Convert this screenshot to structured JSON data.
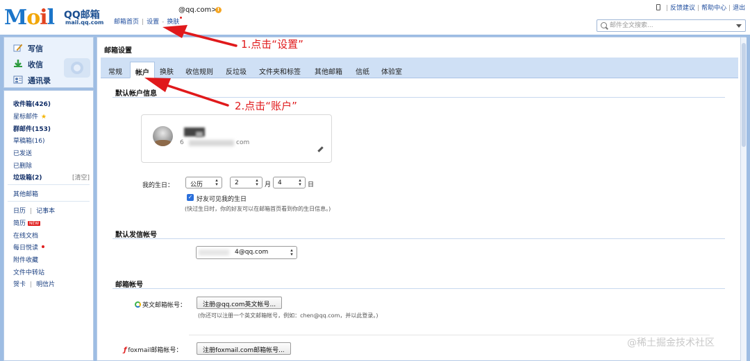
{
  "header": {
    "logo_text": "Mail",
    "logo_brand": "QQ邮箱",
    "logo_url": "mail.qq.com",
    "user_email": "@qq.com>",
    "nav": [
      "邮箱首页",
      "设置",
      "换肤"
    ],
    "top_links": [
      "反馈建议",
      "帮助中心",
      "退出"
    ],
    "search_placeholder": "邮件全文搜索..."
  },
  "sidebar": {
    "quick_actions": [
      "写信",
      "收信",
      "通讯录"
    ],
    "folders": [
      {
        "label": "收件箱(426)",
        "bold": true
      },
      {
        "label": "星标邮件",
        "bold": false
      },
      {
        "label": "群邮件(153)",
        "bold": true
      },
      {
        "label": "草稿箱(16)",
        "bold": false
      },
      {
        "label": "已发送",
        "bold": false
      },
      {
        "label": "已删除",
        "bold": false
      },
      {
        "label": "垃圾箱(2)",
        "bold": true
      }
    ],
    "clear_label": "[清空]",
    "other_mailbox": "其他邮箱",
    "calendar": "日历",
    "notes": "记事本",
    "resume": "简历",
    "new_badge": "NEW",
    "online_docs": "在线文档",
    "daily_read": "每日悦读",
    "attachments": "附件收藏",
    "file_transfer": "文件中转站",
    "greeting_card": "贺卡",
    "postcard": "明信片"
  },
  "main": {
    "title": "邮箱设置",
    "tabs": [
      "常规",
      "帐户",
      "换肤",
      "收信规则",
      "反垃圾",
      "文件夹和标签",
      "其他邮箱",
      "信纸",
      "体验室"
    ],
    "active_tab": 1,
    "section_default_account": "默认帐户信息",
    "account_email_prefix": "6",
    "account_email_suffix": "com",
    "birthday": {
      "label": "我的生日：",
      "calendar_type": "公历",
      "month": "2",
      "month_unit": "月",
      "day": "4",
      "day_unit": "日",
      "checkbox_label": "好友可见我的生日",
      "hint": "(快过生日时，你的好友可以在邮箱首页看到你的生日信息。)"
    },
    "section_default_sender": "默认发信帐号",
    "sender_value": "4@qq.com",
    "section_mail_account": "邮箱帐号",
    "english_account_label": "英文邮箱帐号：",
    "english_account_button": "注册@qq.com英文帐号...",
    "english_account_hint": "(你还可以注册一个英文邮箱帐号，例如：chen@qq.com，并以此登录。)",
    "foxmail_account_label": "foxmail邮箱帐号：",
    "foxmail_account_button": "注册foxmail.com邮箱帐号..."
  },
  "annotations": {
    "step1": "1.点击“设置”",
    "step2": "2.点击“账户”"
  },
  "watermark": "@稀土掘金技术社区"
}
